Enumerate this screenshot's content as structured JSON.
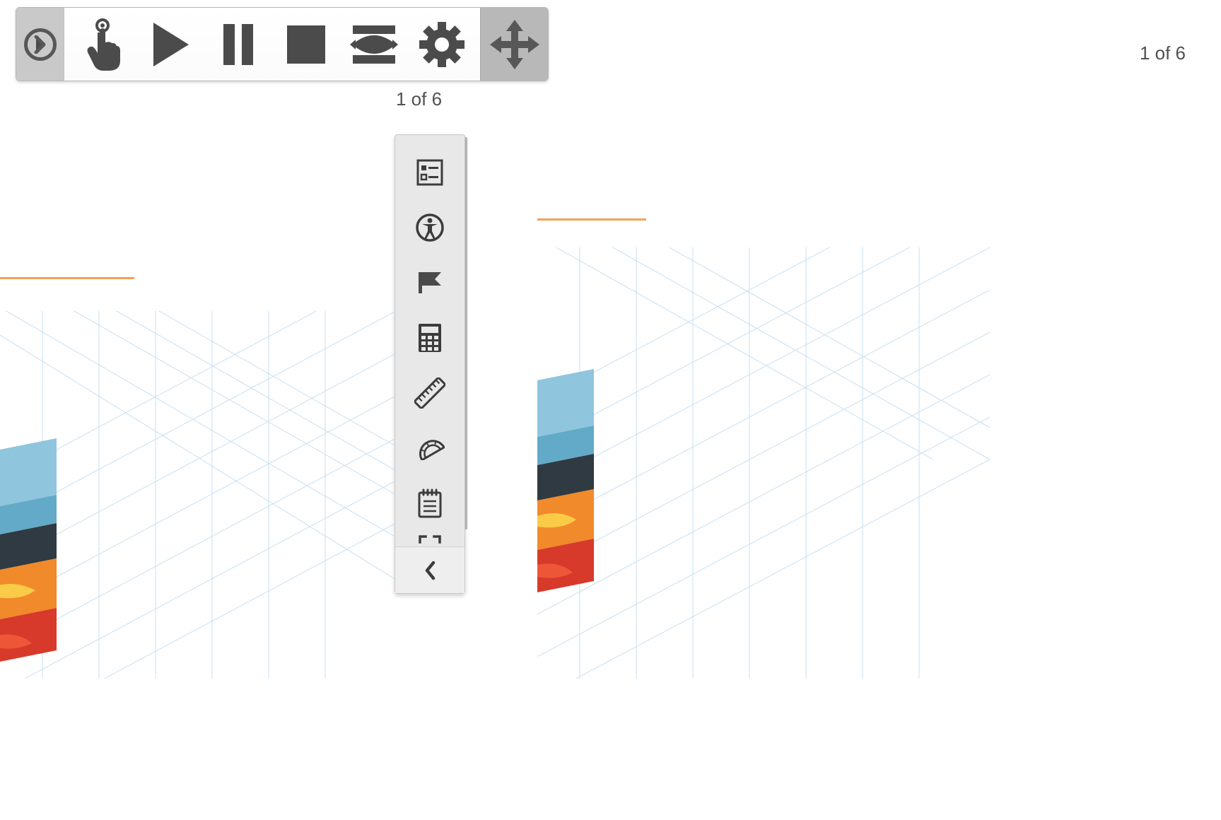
{
  "counters": {
    "left": "1 of 6",
    "right": "1 of 6"
  },
  "horizontal_toolbar": {
    "expand": {
      "name": "expand-recorder-button",
      "icon": "chevron-right-icon"
    },
    "tools": [
      {
        "name": "touch-button",
        "icon": "touch-icon"
      },
      {
        "name": "play-button",
        "icon": "play-icon"
      },
      {
        "name": "pause-button",
        "icon": "pause-icon"
      },
      {
        "name": "stop-button",
        "icon": "stop-icon"
      },
      {
        "name": "review-button",
        "icon": "eye-scan-icon"
      },
      {
        "name": "settings-button",
        "icon": "gear-icon"
      }
    ],
    "move": {
      "name": "move-toolbar-button",
      "icon": "move-arrows-icon"
    }
  },
  "vertical_toolbar": {
    "tools": [
      {
        "name": "references-button",
        "icon": "list-panel-icon"
      },
      {
        "name": "accessibility-button",
        "icon": "accessibility-icon"
      },
      {
        "name": "bookmark-button",
        "icon": "flag-icon"
      },
      {
        "name": "calculator-button",
        "icon": "calculator-icon"
      },
      {
        "name": "ruler-button",
        "icon": "ruler-icon"
      },
      {
        "name": "protractor-button",
        "icon": "protractor-icon"
      },
      {
        "name": "notepad-button",
        "icon": "notepad-icon"
      }
    ],
    "peek": {
      "name": "fullscreen-button",
      "icon": "fullscreen-corners-icon"
    },
    "collapse": {
      "name": "collapse-button",
      "icon": "chevron-left-icon"
    }
  },
  "content": {
    "left": {
      "name": "earth-layers-illustration-left"
    },
    "right": {
      "name": "earth-layers-illustration-right"
    }
  }
}
